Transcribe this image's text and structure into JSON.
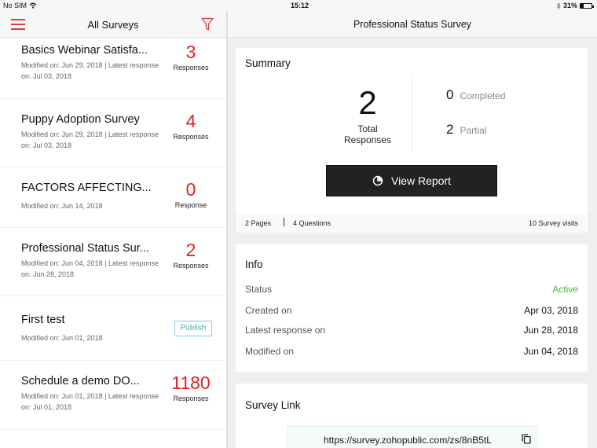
{
  "status_bar": {
    "carrier": "No SIM",
    "time": "15:12",
    "battery_percent_label": "31%",
    "battery_level": 0.31
  },
  "left_header": {
    "title": "All Surveys",
    "menu_icon": "hamburger-menu-icon",
    "filter_icon": "filter-funnel-icon"
  },
  "surveys": [
    {
      "name": "Basics Webinar Satisfa...",
      "meta": "Modified on: Jun 29, 2018  |  Latest response on: Jul 03, 2018",
      "count": "3",
      "count_label": "Responses"
    },
    {
      "name": "Puppy Adoption Survey",
      "meta": "Modified on: Jun 29, 2018  |  Latest response on: Jul 03, 2018",
      "count": "4",
      "count_label": "Responses"
    },
    {
      "name": "FACTORS AFFECTING...",
      "meta": "Modified on: Jun 14, 2018",
      "count": "0",
      "count_label": "Response"
    },
    {
      "name": "Professional Status Sur...",
      "meta": "Modified on: Jun 04, 2018  |  Latest response on: Jun 28, 2018",
      "count": "2",
      "count_label": "Responses"
    },
    {
      "name": "First test",
      "meta": "Modified on: Jun 01, 2018",
      "action_label": "Publish"
    },
    {
      "name": "Schedule a demo DO...",
      "meta": "Modified on: Jun 01, 2018  |  Latest response on: Jul 01, 2018",
      "count": "1180",
      "count_label": "Responses"
    }
  ],
  "right_header": {
    "title": "Professional Status Survey"
  },
  "summary": {
    "title": "Summary",
    "total": "2",
    "total_label": "Total Responses",
    "completed_count": "0",
    "completed_label": "Completed",
    "partial_count": "2",
    "partial_label": "Partial",
    "view_report_label": "View Report",
    "view_report_icon": "pie-chart-icon",
    "pages": "2 Pages",
    "questions": "4 Questions",
    "visits": "10 Survey visits"
  },
  "info": {
    "title": "Info",
    "rows": [
      {
        "key": "Status",
        "value": "Active"
      },
      {
        "key": "Created on",
        "value": "Apr 03, 2018"
      },
      {
        "key": "Latest response on",
        "value": "Jun 28, 2018"
      },
      {
        "key": "Modified on",
        "value": "Jun 04, 2018"
      }
    ]
  },
  "survey_link": {
    "title": "Survey Link",
    "url": "https://survey.zohopublic.com/zs/8nB5tL",
    "copy_icon": "copy-icon"
  },
  "colors": {
    "accent_red": "#e32020",
    "active_green": "#3cb93c",
    "publish_teal": "#3ab5b7",
    "button_dark": "#222222"
  }
}
